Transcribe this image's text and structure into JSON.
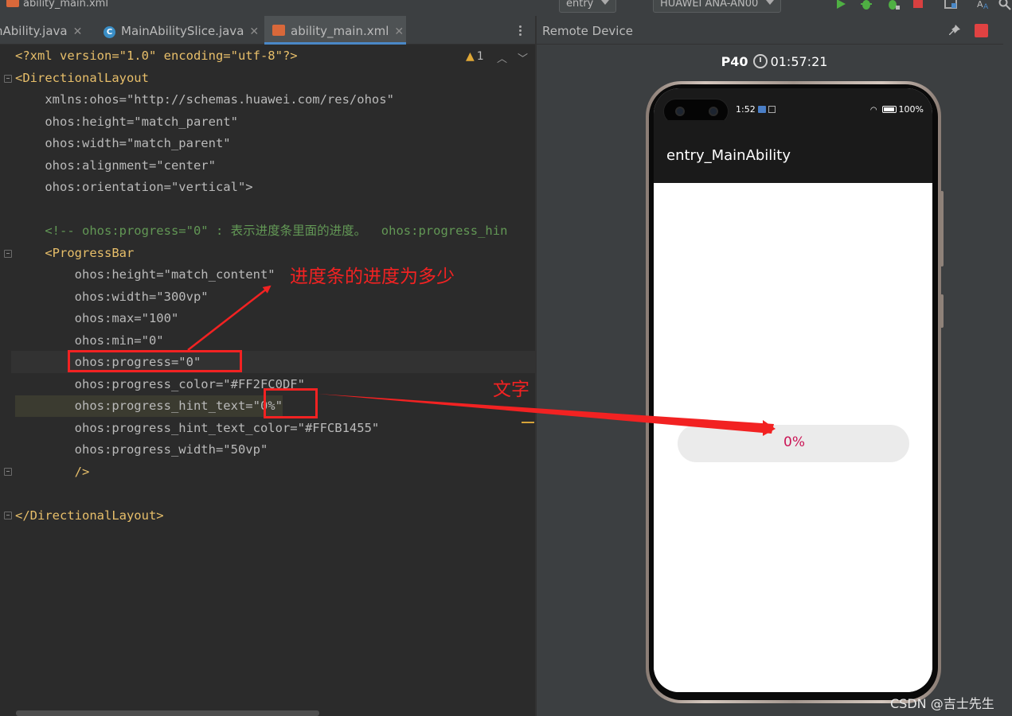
{
  "toolbar": {
    "file_title": "ability_main.xml",
    "run_config": "entry",
    "device": "HUAWEI ANA-AN00"
  },
  "tabs": [
    {
      "label": "nAbility.java",
      "active": false,
      "icon": "none"
    },
    {
      "label": "MainAbilitySlice.java",
      "active": false,
      "icon": "java-class-icon"
    },
    {
      "label": "ability_main.xml",
      "active": true,
      "icon": "xml-file-icon"
    }
  ],
  "editor": {
    "warning_count": "1",
    "code_lines": [
      "<?xml version=\"1.0\" encoding=\"utf-8\"?>",
      "<DirectionalLayout",
      "    xmlns:ohos=\"http://schemas.huawei.com/res/ohos\"",
      "    ohos:height=\"match_parent\"",
      "    ohos:width=\"match_parent\"",
      "    ohos:alignment=\"center\"",
      "    ohos:orientation=\"vertical\">",
      "",
      "    <!-- ohos:progress=\"0\" : 表示进度条里面的进度。  ohos:progress_hin",
      "    <ProgressBar",
      "        ohos:height=\"match_content\"",
      "        ohos:width=\"300vp\"",
      "        ohos:max=\"100\"",
      "        ohos:min=\"0\"",
      "        ohos:progress=\"0\"",
      "        ohos:progress_color=\"#FF2FC0DF\"",
      "        ohos:progress_hint_text=\"0%\"",
      "        ohos:progress_hint_text_color=\"#FFCB1455\"",
      "        ohos:progress_width=\"50vp\"",
      "        />",
      "",
      "</DirectionalLayout>"
    ]
  },
  "annotations": {
    "progress_note": "进度条的进度为多少",
    "text_note": "文字"
  },
  "remote_device": {
    "panel_title": "Remote Device",
    "device_model": "P40",
    "timer": "01:57:21",
    "status_time": "1:52",
    "battery": "100%",
    "app_title": "entry_MainAbility",
    "progress_hint_text": "0%",
    "progress_value": 0,
    "progress_min": 0,
    "progress_max": 100,
    "progress_color": "#FF2FC0",
    "progress_hint_color": "#CB1455"
  },
  "watermark": "CSDN @吉士先生"
}
